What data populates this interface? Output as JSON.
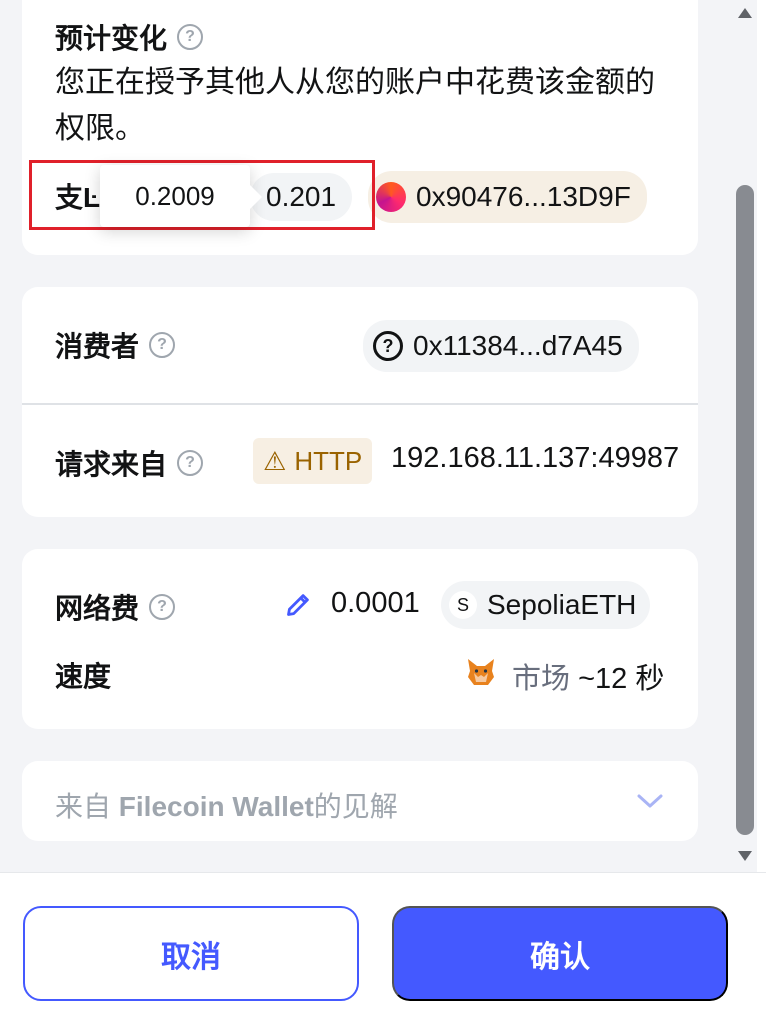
{
  "estimated_changes": {
    "title": "预计变化",
    "description": "您正在授予其他人从您的账户中花费该金额的权限。",
    "spend_label_partial": "支Ŀ",
    "tooltip_value": "0.2009",
    "amount": "0.201",
    "token_address": "0x90476...13D9F"
  },
  "spender": {
    "label": "消费者",
    "address": "0x11384...d7A45"
  },
  "request_from": {
    "label": "请求来自",
    "badge": "HTTP",
    "origin": "192.168.11.137:49987"
  },
  "network_fee": {
    "label": "网络费",
    "amount": "0.0001",
    "network_letter": "S",
    "currency": "SepoliaETH"
  },
  "speed": {
    "label": "速度",
    "market": "市场",
    "time": "~12 秒"
  },
  "insights": {
    "prefix": "来自",
    "brand": "Filecoin Wallet",
    "suffix": "的见解"
  },
  "footer": {
    "cancel_label": "取消",
    "confirm_label": "确认"
  },
  "colors": {
    "accent": "#4459ff",
    "highlight": "#e0202a",
    "warning": "#9a6300"
  }
}
